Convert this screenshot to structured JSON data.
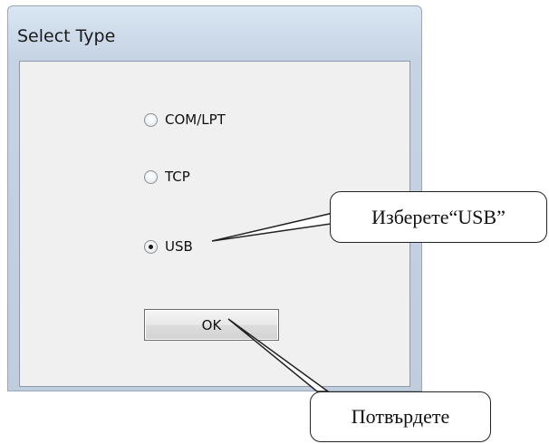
{
  "dialog": {
    "title": "Select Type",
    "options": [
      {
        "label": "COM/LPT",
        "selected": false
      },
      {
        "label": "TCP",
        "selected": false
      },
      {
        "label": "USB",
        "selected": true
      }
    ],
    "ok_label": "OK"
  },
  "annotations": {
    "select_usb": "Изберете“USB”",
    "confirm": "Потвърдете"
  }
}
